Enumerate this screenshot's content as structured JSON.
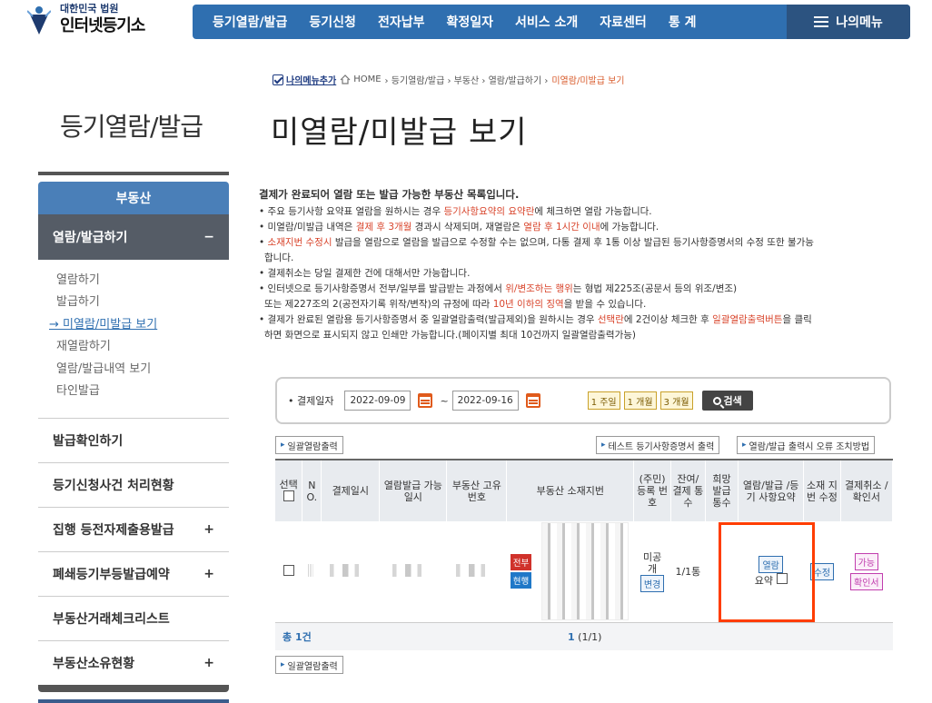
{
  "logo": {
    "court": "대한민국 법원",
    "site": "인터넷등기소"
  },
  "gnb": {
    "items": [
      "등기열람/발급",
      "등기신청",
      "전자납부",
      "확정일자",
      "서비스 소개",
      "자료센터",
      "통 계"
    ],
    "mymenu": "나의메뉴"
  },
  "breadcrumb": {
    "add": "나의메뉴추가",
    "home": "HOME",
    "path": "› 등기열람/발급 › 부동산 › 열람/발급하기 ›",
    "current": "미열람/미발급 보기"
  },
  "sidebar": {
    "title": "등기열람/발급",
    "category": "부동산",
    "active": "열람/발급하기",
    "active_toggle": "−",
    "sub": [
      "열람하기",
      "발급하기",
      "→ 미열람/미발급 보기",
      "재열람하기",
      "열람/발급내역 보기",
      "타인발급"
    ],
    "menu": [
      {
        "label": "발급확인하기",
        "toggle": ""
      },
      {
        "label": "등기신청사건 처리현황",
        "toggle": ""
      },
      {
        "label": "집행 등전자제출용발급",
        "toggle": "+"
      },
      {
        "label": "폐쇄등기부등발급예약",
        "toggle": "+"
      },
      {
        "label": "부동산거래체크리스트",
        "toggle": ""
      },
      {
        "label": "부동산소유현황",
        "toggle": "+"
      }
    ]
  },
  "main": {
    "title": "미열람/미발급 보기",
    "notice_head": "결제가 완료되어 열람 또는 발급 가능한 부동산 목록입니다.",
    "notice": [
      [
        "• 주요 등기사항 요약표 열람을 원하시는 경우 ",
        "등기사항요약의 요약란",
        "에 체크하면 열람 가능합니다."
      ],
      [
        "• 미열람/미발급 내역은 ",
        "결제 후 3개월",
        " 경과시 삭제되며, 재열람은 ",
        "열람 후 1시간 이내",
        "에 가능합니다."
      ],
      [
        "• ",
        "소재지번 수정시",
        " 발급을 열람으로 열람을 발급으로 수정할 수는 없으며, 다통 결제 후 1통 이상 발급된 등기사항증명서의 수정 또한 불가능"
      ],
      [
        "  합니다."
      ],
      [
        "• 결제취소는 당일 결제한 건에 대해서만 가능합니다."
      ],
      [
        "• 인터넷으로 등기사항증명서 전부/일부를 발급받는 과정에서 ",
        "위/변조하는 행위",
        "는 형법 제225조(공문서 등의 위조/변조)"
      ],
      [
        "  또는 제227조의 2(공전자기록 위작/변작)의 규정에 따라 ",
        "10년 이하의 징역",
        "을 받을 수 있습니다."
      ],
      [
        "• 결제가 완료된 열람용 등기사항증명서 중 일괄열람출력(발급제외)을 원하시는 경우 ",
        "선택란",
        "에 2건이상 체크한 후 ",
        "일괄열람출력버튼",
        "을 클릭"
      ],
      [
        "  하면 화면으로 표시되지 않고 인쇄만 가능합니다.(페이지별 최대 10건까지 일괄열람출력가능)"
      ]
    ],
    "search": {
      "label": "• 결제일자",
      "from": "2022-09-09",
      "tilde": "~",
      "to": "2022-09-16",
      "periods": [
        "1 주일",
        "1 개월",
        "3 개월"
      ],
      "button": "검색"
    },
    "buttons": {
      "batch_print": "일괄열람출력",
      "test_print": "테스트 등기사항증명서 출력",
      "error_help": "열람/발급 출력시 오류 조치방법"
    },
    "table": {
      "headers": [
        "선택",
        "N O.",
        "결제일시",
        "열람발급 가능일시",
        "부동산 고유번호",
        "부동산 소재지번",
        "(주민) 등록 번호",
        "잔여/ 결제 통수",
        "희망 발급 통수",
        "열람/발급 /등기 사항요약",
        "소재 지번 수정",
        "결제취소 /확인서"
      ],
      "row": {
        "tag_all": "전부",
        "tag_current": "현행",
        "id_status": "미공개",
        "change": "변경",
        "count": "1/1통",
        "view": "열람",
        "summary": "요약",
        "modify": "수정",
        "possible": "가능",
        "receipt": "확인서"
      }
    },
    "footer": {
      "total_prefix": "총",
      "total_count": "1",
      "total_suffix": "건",
      "page": "1",
      "page_info": "(1/1)"
    }
  }
}
